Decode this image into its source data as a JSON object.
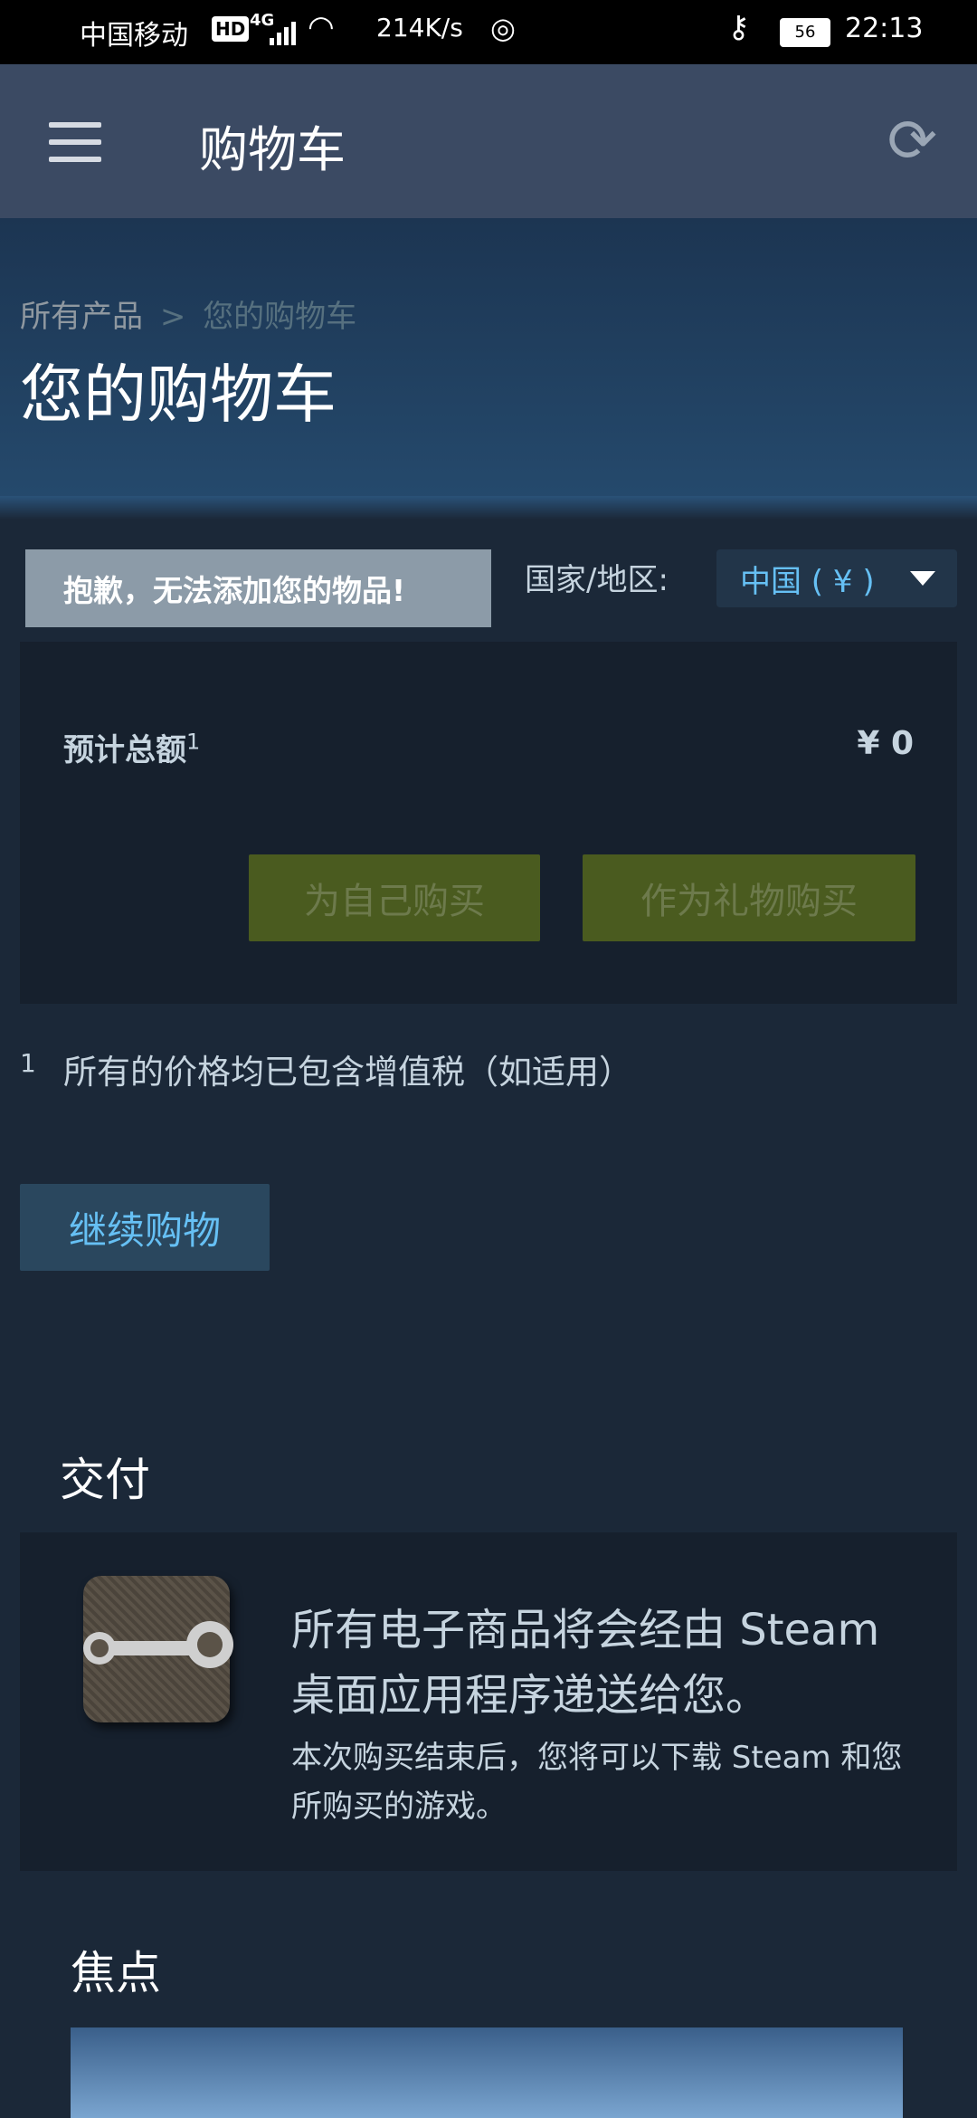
{
  "status_bar": {
    "carrier": "中国移动",
    "hd": "HD",
    "network": "4G",
    "speed": "214K/s",
    "battery": "56",
    "time": "22:13"
  },
  "app_bar": {
    "title": "购物车"
  },
  "breadcrumb": {
    "root": "所有产品",
    "separator": ">",
    "current": "您的购物车"
  },
  "page_title": "您的购物车",
  "notice": "抱歉，无法添加您的物品!",
  "country": {
    "label": "国家/地区:",
    "selected": "中国 ( ¥ )"
  },
  "total": {
    "label": "预计总额",
    "footnote_ref": "1",
    "value": "¥ 0"
  },
  "buttons": {
    "buy_self": "为自己购买",
    "buy_gift": "作为礼物购买",
    "continue": "继续购物"
  },
  "footnote": {
    "num": "1",
    "text": "所有的价格均已包含增值税（如适用）"
  },
  "delivery": {
    "title": "交付",
    "main": "所有电子商品将会经由 Steam 桌面应用程序递送给您。",
    "sub": "本次购买结束后，您将可以下载 Steam 和您所购买的游戏。"
  },
  "focus": {
    "title": "焦点"
  },
  "colors": {
    "background": "#1b2838",
    "accent_blue": "#66c0f4",
    "green_button": "#4a5b1f"
  }
}
